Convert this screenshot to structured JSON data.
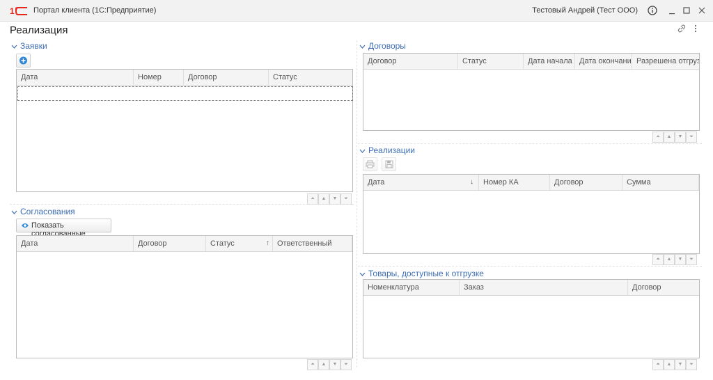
{
  "window": {
    "app_title": "Портал клиента  (1С:Предприятие)",
    "user": "Тестовый Андрей (Тест ООО)",
    "info_icon": "info-icon",
    "minimize_icon": "minimize-icon",
    "maximize_icon": "maximize-icon",
    "close_icon": "close-icon"
  },
  "page": {
    "title": "Реализация",
    "link_icon": "link-icon",
    "more_icon": "more-vertical-icon"
  },
  "requests": {
    "title": "Заявки",
    "add_icon": "plus-circle-icon",
    "columns": [
      "Дата",
      "Номер",
      "Договор",
      "Статус"
    ]
  },
  "approvals": {
    "title": "Согласования",
    "show_button": "Показать согласованные",
    "show_icon": "eye-icon",
    "columns": [
      "Дата",
      "Договор",
      "Статус",
      "Ответственный"
    ],
    "sort_column": "Статус",
    "sort_direction": "ascending"
  },
  "contracts": {
    "title": "Договоры",
    "columns": [
      "Договор",
      "Статус",
      "Дата начала",
      "Дата окончания",
      "Разрешена отгрузка"
    ]
  },
  "sales": {
    "title": "Реализации",
    "print_icon": "print-icon",
    "save_icon": "save-icon",
    "columns": [
      "Дата",
      "Номер КА",
      "Договор",
      "Сумма"
    ],
    "sort_column": "Дата",
    "sort_direction": "descending"
  },
  "goods": {
    "title": "Товары, доступные к отгрузке",
    "columns": [
      "Номенклатура",
      "Заказ",
      "Договор"
    ]
  },
  "colors": {
    "accent": "#3d6db5",
    "logo": "#e8261b",
    "add_button": "#2f86d6"
  }
}
